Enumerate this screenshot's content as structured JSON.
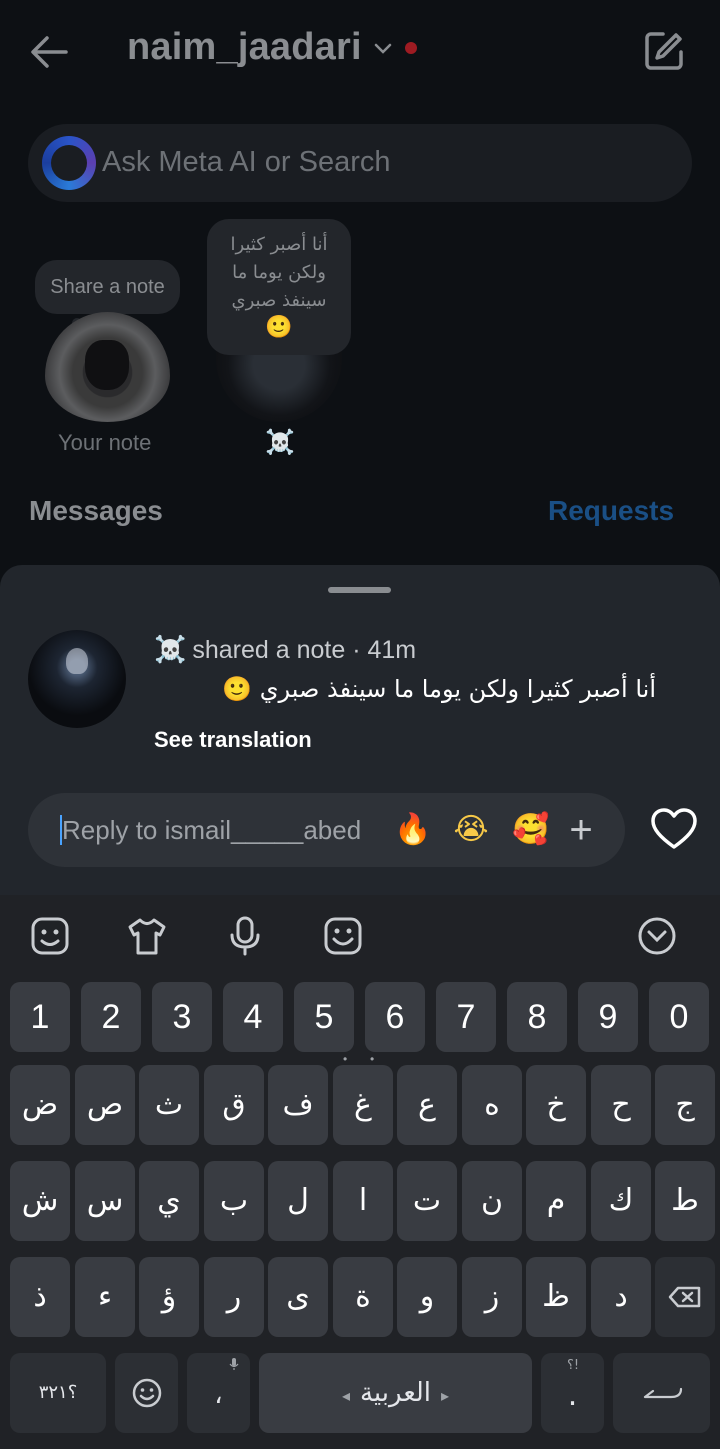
{
  "header": {
    "username": "naim_jaadari",
    "back_icon": "arrow-left-icon",
    "compose_icon": "compose-icon",
    "dot_color": "#9e1b22"
  },
  "search": {
    "placeholder": "Ask Meta AI or Search"
  },
  "notes": {
    "own": {
      "bubble": "Share a note",
      "label": "Your note"
    },
    "friend": {
      "lines": [
        "أنا أصبر كثيرا",
        "ولكن يوما ما",
        "سينفذ صبري"
      ],
      "emoji": "🙂",
      "label": "☠️"
    }
  },
  "sections": {
    "messages": "Messages",
    "requests": "Requests",
    "requests_color": "#1a4f85"
  },
  "sheet": {
    "sender_emoji": "☠️",
    "meta": "shared a note · 41m",
    "note_text": "أنا أصبر كثيرا ولكن يوما ما سينفذ صبري",
    "note_emoji": "🙂",
    "see_translation": "See translation",
    "reply_placeholder": "Reply to ismail_____abed",
    "reactions": [
      "🔥",
      "😭",
      "🥰",
      "+"
    ]
  },
  "keyboard": {
    "tools": [
      "sticker-icon",
      "shirt-icon",
      "microphone-icon",
      "emoji-board-icon",
      "collapse-icon"
    ],
    "number_row": [
      "1",
      "2",
      "3",
      "4",
      "5",
      "6",
      "7",
      "8",
      "9",
      "0"
    ],
    "row1": [
      "ض",
      "ص",
      "ث",
      "ق",
      "ف",
      "غ",
      "ع",
      "ه",
      "خ",
      "ح",
      "ج"
    ],
    "row2": [
      "ش",
      "س",
      "ي",
      "ب",
      "ل",
      "ا",
      "ت",
      "ن",
      "م",
      "ك",
      "ط"
    ],
    "row3": [
      "ذ",
      "ء",
      "ؤ",
      "ر",
      "ى",
      "ة",
      "و",
      "ز",
      "ظ",
      "د"
    ],
    "bottom": {
      "numbers_key": "؟٣٢١",
      "comma": "،",
      "space_label": "العربية",
      "period": ".",
      "period_hint": "؟!",
      "enter": "↵"
    }
  }
}
